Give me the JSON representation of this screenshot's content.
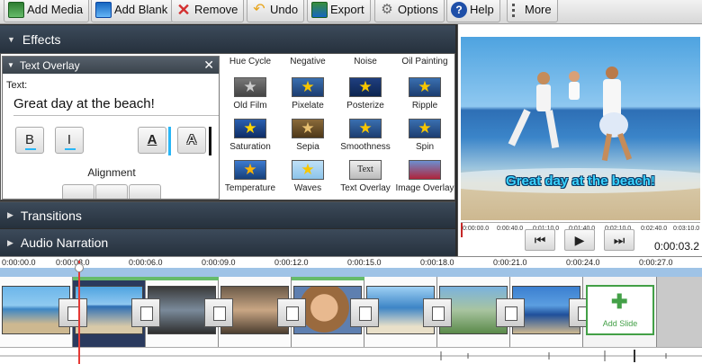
{
  "toolbar": {
    "buttons": [
      {
        "label": "Add Media",
        "icon": "add-media-icon"
      },
      {
        "label": "Add Blank",
        "icon": "add-blank-icon"
      },
      {
        "label": "Remove",
        "icon": "remove-icon"
      },
      {
        "label": "Undo",
        "icon": "undo-icon"
      },
      {
        "label": "Export",
        "icon": "export-icon"
      },
      {
        "label": "Options",
        "icon": "options-icon"
      },
      {
        "label": "Help",
        "icon": "help-icon"
      },
      {
        "label": "More",
        "icon": "more-icon"
      }
    ]
  },
  "effects": {
    "header": "Effects",
    "overlay": {
      "title": "Text Overlay",
      "close": "✕",
      "text_label": "Text:",
      "text_value": "Great day at the beach!",
      "bold_label": "B",
      "italic_label": "I",
      "color_label": "A",
      "outline_label": "A",
      "alignment_label": "Alignment"
    },
    "top_labels": [
      "Hue Cycle",
      "Negative",
      "Noise",
      "Oil Painting"
    ],
    "items": [
      "Old Film",
      "Pixelate",
      "Posterize",
      "Ripple",
      "Saturation",
      "Sepia",
      "Smoothness",
      "Spin",
      "Temperature",
      "Waves",
      "Text Overlay",
      "Image Overlay"
    ]
  },
  "sections": {
    "transitions": "Transitions",
    "audio": "Audio Narration"
  },
  "preview": {
    "caption": "Great day at the beach!",
    "ruler": [
      "0:00:00.0",
      "0:00:40.0",
      "0:01:10.0",
      "0:01:40.0",
      "0:02:10.0",
      "0:02:40.0",
      "0:03:10.0"
    ],
    "time": "0:00:03.2"
  },
  "timeline": {
    "ticks": [
      "0:00:00.0",
      "0:00:03.0",
      "0:00:06.0",
      "0:00:09.0",
      "0:00:12.0",
      "0:00:15.0",
      "0:00:18.0",
      "0:00:21.0",
      "0:00:24.0",
      "0:00:27.0"
    ],
    "add_slide": "Add Slide"
  },
  "colors": {
    "accent_cyan": "#29b6f6",
    "panel_header": "#2f3a46",
    "add_slide_green": "#43a047",
    "playhead": "#e53935"
  }
}
